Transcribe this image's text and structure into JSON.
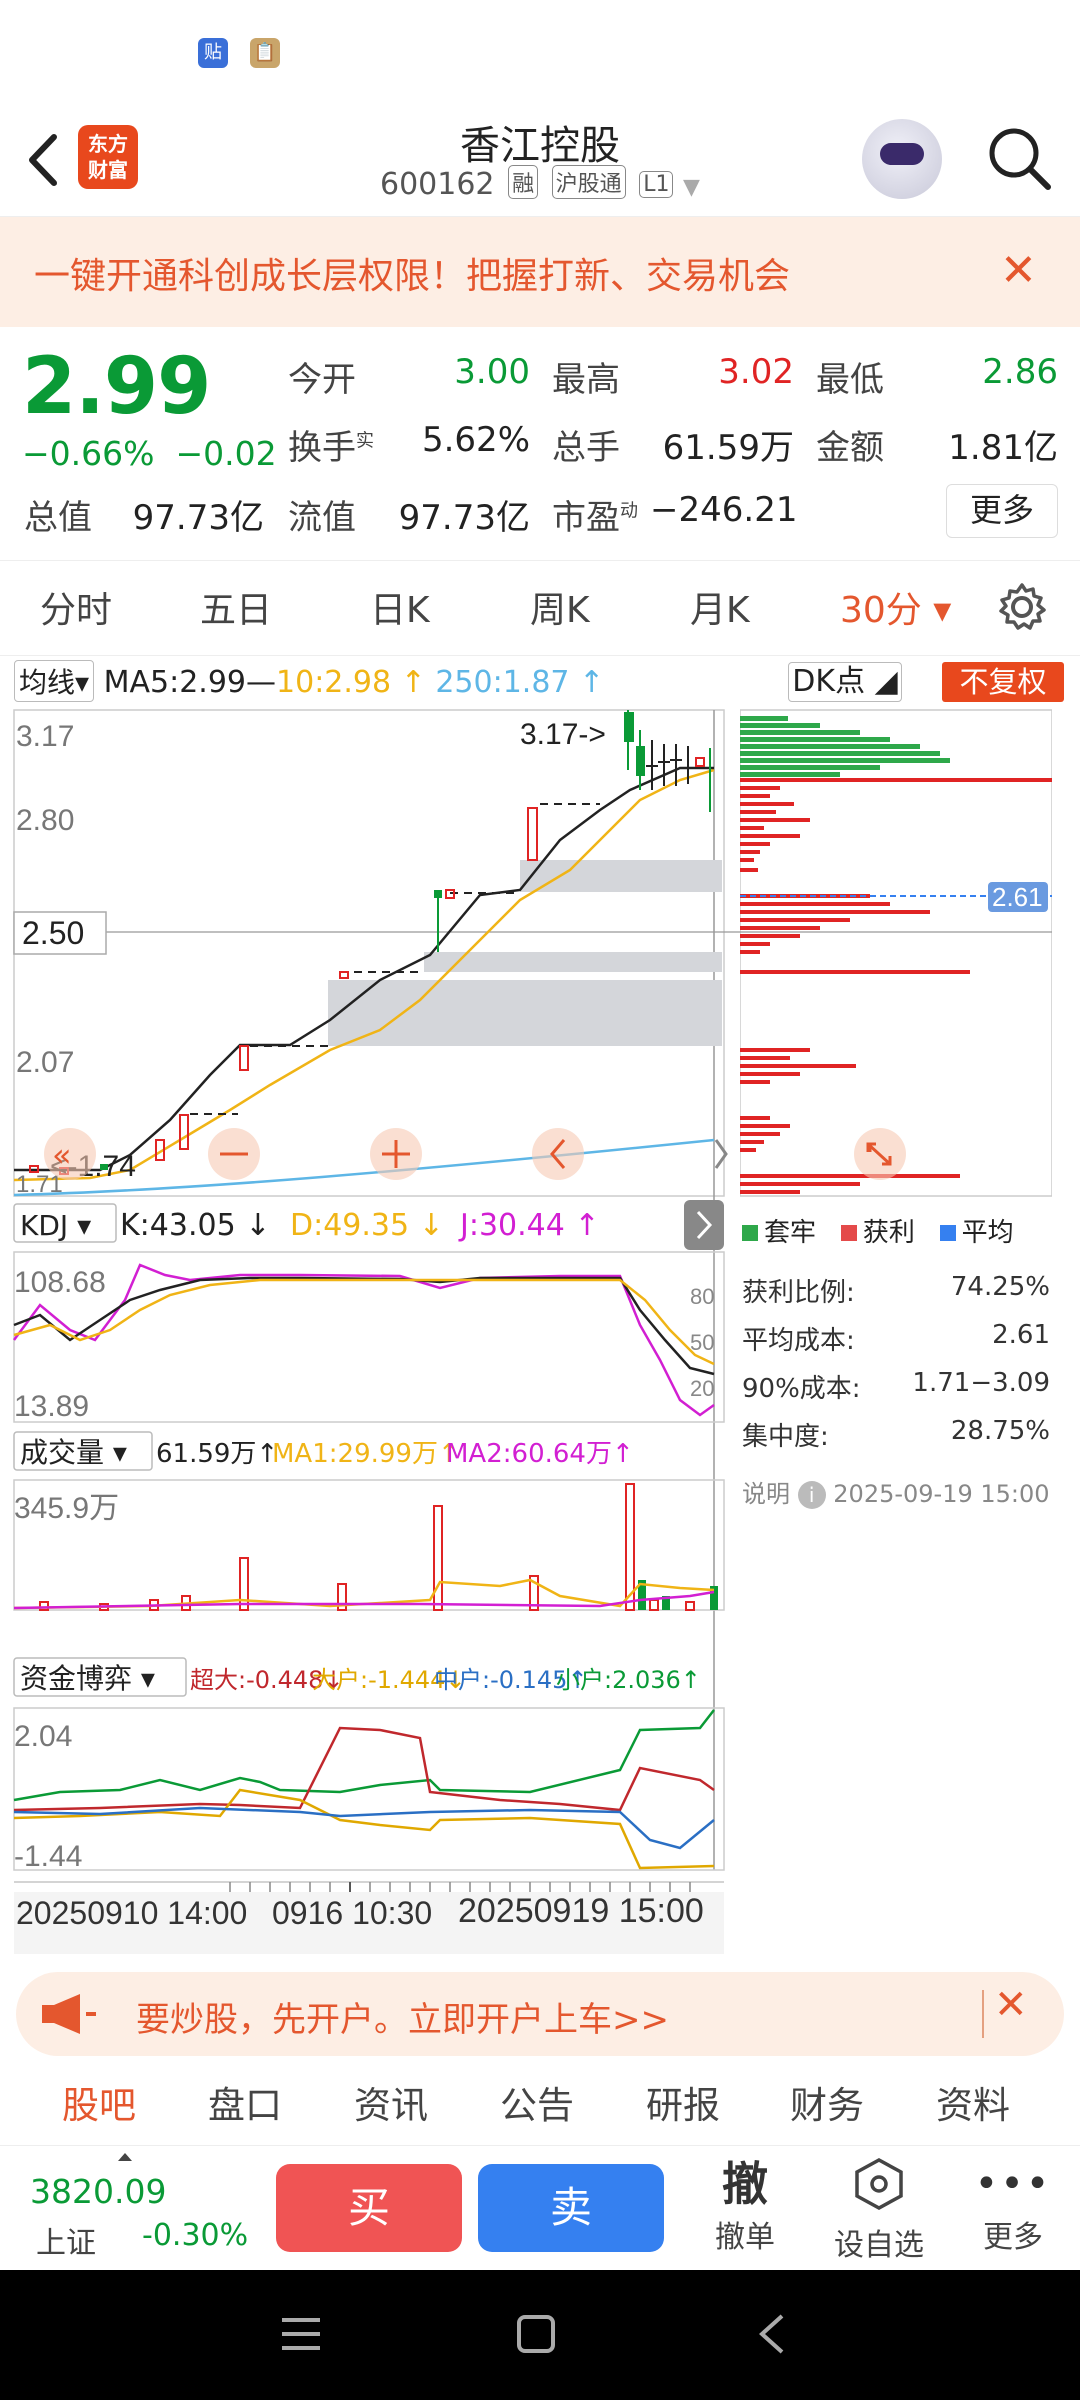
{
  "status_icons": [
    "贴",
    "📋"
  ],
  "header": {
    "title": "香江控股",
    "code": "600162",
    "tags": [
      "融",
      "沪股通",
      "L1"
    ],
    "logo_line1": "东方",
    "logo_line2": "财富"
  },
  "banner": {
    "text": "一键开通科创成长层权限！把握打新、交易机会"
  },
  "quote": {
    "price": "2.99",
    "change_pct": "−0.66%",
    "change_abs": "−0.02",
    "open_label": "今开",
    "open": "3.00",
    "high_label": "最高",
    "high": "3.02",
    "low_label": "最低",
    "low": "2.86",
    "turnover_label": "换手",
    "turnover_sup": "实",
    "turnover": "5.62%",
    "volume_label": "总手",
    "volume": "61.59万",
    "amount_label": "金额",
    "amount": "1.81亿",
    "mktcap_label": "总值",
    "mktcap": "97.73亿",
    "float_label": "流值",
    "float": "97.73亿",
    "pe_label": "市盈",
    "pe_sup": "动",
    "pe": "−246.21",
    "more": "更多"
  },
  "tabs": [
    {
      "label": "分时"
    },
    {
      "label": "五日"
    },
    {
      "label": "日K"
    },
    {
      "label": "周K"
    },
    {
      "label": "月K"
    },
    {
      "label": "30分 ▾"
    }
  ],
  "ma_bar": {
    "selector": "均线▾",
    "ma5": "MA5:2.99—",
    "ma10": "10:2.98 ↑",
    "ma250": "250:1.87 ↑",
    "dk": "DK点 ◢",
    "fuquan": "不复权"
  },
  "main_chart": {
    "label_317": "3.17",
    "label_280": "2.80",
    "label_250": "2.50",
    "label_207": "2.07",
    "label_171": "1.71",
    "annot_high": "3.17->",
    "annot_low": "<-1.74",
    "chip_avg": "2.61"
  },
  "kdj": {
    "selector": "KDJ ▾",
    "k": "K:43.05 ↓",
    "d": "D:49.35 ↓",
    "j": "J:30.44 ↑",
    "top": "108.68",
    "bottom": "13.89",
    "lv80": "80",
    "lv50": "50",
    "lv20": "20"
  },
  "volume": {
    "selector": "成交量 ▾",
    "vol": "61.59万↑",
    "ma1": "MA1:29.99万↑",
    "ma2": "MA2:60.64万↑",
    "top": "345.9万"
  },
  "fund": {
    "selector": "资金博弈 ▾",
    "super": "超大:-0.448↓",
    "big": "大户:-1.444↓",
    "mid": "中户:-0.145↑",
    "small": "小户:2.036↑",
    "top": "2.04",
    "bottom": "-1.44"
  },
  "time_axis": {
    "t1": "20250910 14:00",
    "t2": "0916 10:30",
    "t3": "20250919 15:00"
  },
  "chip": {
    "legend": [
      "套牢",
      "获利",
      "平均"
    ],
    "rows": [
      {
        "k": "获利比例:",
        "v": "74.25%"
      },
      {
        "k": "平均成本:",
        "v": "2.61"
      },
      {
        "k": "90%成本:",
        "v": "1.71−3.09"
      },
      {
        "k": "集中度:",
        "v": "28.75%"
      }
    ],
    "note": "说明",
    "date": "2025-09-19 15:00"
  },
  "ad": {
    "text": "要炒股，先开户。立即开户上车>>"
  },
  "news_tabs": [
    "股吧",
    "盘口",
    "资讯",
    "公告",
    "研报",
    "财务",
    "资料"
  ],
  "bottom": {
    "index_val": "3820.09",
    "index_name": "上证",
    "index_chg": "-0.30%",
    "buy": "买",
    "sell": "卖",
    "cancel_icon": "撤",
    "cancel": "撤单",
    "fav": "设自选",
    "more": "更多"
  }
}
